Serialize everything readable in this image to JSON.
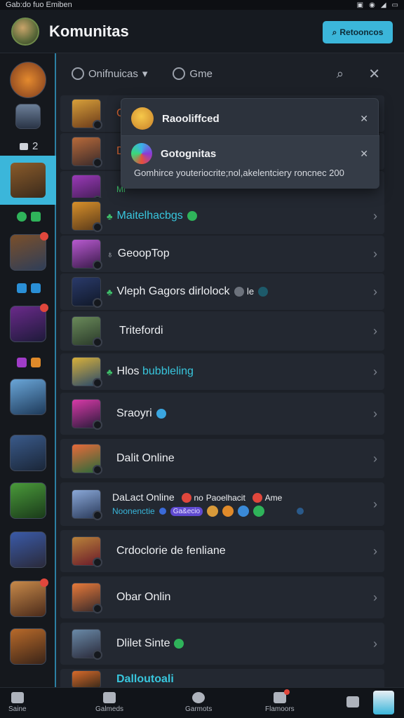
{
  "statusbar": {
    "text": "Gab:do fuo Emiben",
    "icons": [
      "photo-icon",
      "wifi-icon",
      "signal-icon",
      "battery-icon"
    ]
  },
  "header": {
    "title": "Komunitas",
    "button_label": "Retooncos"
  },
  "sidebar": {
    "count_label": "2"
  },
  "toolbar": {
    "filter_label": "Onifnuicas",
    "games_label": "Gme"
  },
  "popup": {
    "item1_title": "Raooliffced",
    "item2_title": "Gotognitas",
    "description": "Gomhirce youteriocrite;nol,akelentciery roncnec 200"
  },
  "list": {
    "row1": "Cli",
    "row2": "Dk",
    "row3": "Mi",
    "row4": "Maitelhacbgs",
    "row5": "GeoopTop",
    "row6": "Vleph Gagors dirlolock",
    "row6_extra": "le",
    "row7": "Tritefordi",
    "row8_prefix": "Hlos",
    "row8_suffix": "bubbleling",
    "row9": "Sraoyri",
    "row10": "Dalit Online",
    "row11_top": "DaLact Online",
    "row11_top_mid": "no",
    "row11_top_right": "Paoelhacit",
    "row11_top_end": "Ame",
    "row11_sub": "Noonenctie",
    "row11_pill": "Ga&ecio",
    "row12": "Crdoclorie de fenliane",
    "row13": "Obar Onlin",
    "row14": "Dlilet Sinte",
    "row15": "Dalloutoali"
  },
  "bottomnav": {
    "item1": "Saine",
    "item2": "Galmeds",
    "item3": "Garmots",
    "item4": "Flamoors"
  }
}
